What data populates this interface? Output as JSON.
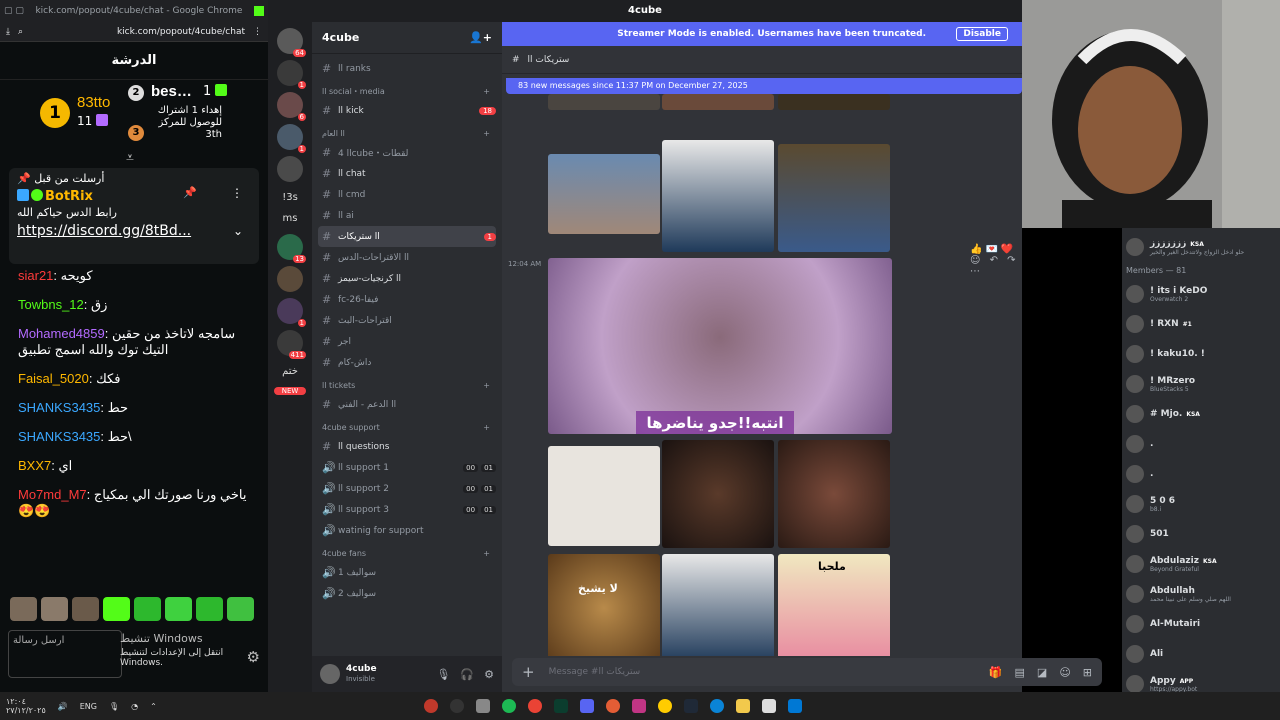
{
  "browser": {
    "title": "kick.com/popout/4cube/chat - Google Chrome",
    "url": "kick.com/popout/4cube/chat"
  },
  "kick": {
    "header": "الدرشة",
    "leaderboard": {
      "first_user": "83tto",
      "first_count": "11",
      "second_user": "bes…",
      "second_count": "1",
      "goal_line1": "إهداء 1 اشتراك",
      "goal_line2": "للوصول للمركز",
      "goal_line3": "3th",
      "rank1": "1",
      "rank2": "2",
      "rank3": "3"
    },
    "pinned": {
      "sent_by": "أرسلت من قبل",
      "bot_name": "BotRix",
      "message": "رابط الدس حياكم الله",
      "link": "https://discord.gg/8tBd..."
    },
    "messages": [
      {
        "user": "siar21",
        "text": ": كويحه",
        "color": "#ff3b3b"
      },
      {
        "user": "Towbns_12",
        "text": ": زق",
        "color": "#53fc18"
      },
      {
        "user": "Mohamed4859",
        "text": ": سامجه لاتاخذ من حقين التيك توك والله اسمج تطبيق",
        "color": "#b36bff"
      },
      {
        "user": "Faisal_5020",
        "text": ": فكك",
        "color": "#ffb800"
      },
      {
        "user": "SHANKS3435",
        "text": ": حط",
        "color": "#3ba8ff"
      },
      {
        "user": "SHANKS3435",
        "text": ": حط\\",
        "color": "#3ba8ff"
      },
      {
        "user": "BXX7",
        "text": ": اي",
        "color": "#ffb800"
      },
      {
        "user": "Mo7md_M7",
        "text": ": ياخي ورنا صورتك الي بمكياج 😍😍",
        "color": "#ff3b3b"
      }
    ],
    "input_placeholder": "ارسل رسالة",
    "windows_activate": "تنشيط Windows",
    "windows_activate_sub": "انتقل إلى الإعدادات لتنشيط Windows."
  },
  "discord": {
    "window_title": "4cube",
    "streamer_mode_text": "Streamer Mode is enabled. Usernames have been truncated.",
    "disable_button": "Disable",
    "guild_name": "4cube",
    "channel_name": "ستريكات اا",
    "new_messages_banner": "83 new messages since 11:37 PM on December 27, 2025",
    "timestamp": "12:04 AM",
    "overlay_caption": "انتبه!!جدو يناضرها",
    "image_caption_1": "لا يشيخ",
    "image_caption_2": "ملحبا",
    "composer_placeholder": "Message #ستريكات اا",
    "user_panel": {
      "name": "4cube",
      "status": "Invisible"
    },
    "servers": [
      {
        "badge": "64"
      },
      {
        "badge": "1"
      },
      {
        "badge": "6"
      },
      {
        "badge": "1"
      },
      {
        "badge": ""
      },
      {
        "badge": "13"
      },
      {
        "badge": ""
      },
      {
        "badge": "1"
      },
      {
        "badge": "411"
      }
    ],
    "server_texts": {
      "s1": "!3s",
      "s2": "ms",
      "s3": "ختم",
      "new": "NEW"
    },
    "channels": [
      {
        "type": "ch",
        "label": "اا ranks",
        "style": ""
      },
      {
        "type": "cat",
        "label": "اا social・media"
      },
      {
        "type": "ch",
        "label": "اا kick",
        "style": "white",
        "num": "18"
      },
      {
        "type": "cat",
        "label": "اا العام"
      },
      {
        "type": "ch",
        "label": "اا 4cube・لقطات",
        "style": ""
      },
      {
        "type": "ch",
        "label": "اا chat",
        "style": "white"
      },
      {
        "type": "ch",
        "label": "اا cmd",
        "style": ""
      },
      {
        "type": "ch",
        "label": "اا ai",
        "style": ""
      },
      {
        "type": "ch",
        "label": "اا ستريكات",
        "style": "active",
        "num": "1"
      },
      {
        "type": "ch",
        "label": "اا الاقتراحات-الدس",
        "style": ""
      },
      {
        "type": "ch",
        "label": "اا كرنجيات-سيمز",
        "style": "white"
      },
      {
        "type": "ch",
        "label": "fc-26-فيفا",
        "style": ""
      },
      {
        "type": "ch",
        "label": "اقتراحات-البث",
        "style": ""
      },
      {
        "type": "ch",
        "label": "اجر",
        "style": ""
      },
      {
        "type": "ch",
        "label": "داش-كام",
        "style": ""
      },
      {
        "type": "cat",
        "label": "اا tickets"
      },
      {
        "type": "ch",
        "label": "اا الدعم - الفني",
        "style": ""
      },
      {
        "type": "cat",
        "label": "4cube support"
      },
      {
        "type": "ch",
        "label": "اا questions",
        "style": "white"
      },
      {
        "type": "voice",
        "label": "اا support 1",
        "a": "00",
        "b": "01"
      },
      {
        "type": "voice",
        "label": "اا support 2",
        "a": "00",
        "b": "01"
      },
      {
        "type": "voice",
        "label": "اا support 3",
        "a": "00",
        "b": "01"
      },
      {
        "type": "voice",
        "label": "watinig for support"
      },
      {
        "type": "cat",
        "label": "4cube fans"
      },
      {
        "type": "voice",
        "label": "سواليف 1"
      },
      {
        "type": "voice",
        "label": "سواليف 2"
      }
    ],
    "members_header": "Members — 81",
    "members": [
      {
        "name": "ززززززز",
        "tag": "KSA",
        "status": "حلو ادخل الزواج ولاتتدخل الغير والخير"
      },
      {
        "name": "! its i KeDO",
        "status": "Overwatch 2"
      },
      {
        "name": "! RXN",
        "tag": "#1"
      },
      {
        "name": "! kaku10. !"
      },
      {
        "name": "! MRzero",
        "status": "BlueStacks 5"
      },
      {
        "name": "# Mjo.",
        "tag": "KSA"
      },
      {
        "name": "."
      },
      {
        "name": "."
      },
      {
        "name": "5 0 6",
        "status": "b8.i"
      },
      {
        "name": "501"
      },
      {
        "name": "Abdulaziz",
        "tag": "KSA",
        "status": "Beyond Grateful"
      },
      {
        "name": "Abdullah",
        "status": "اللهم صلي وسلم على نبينا محمد"
      },
      {
        "name": "Al-Mutairi"
      },
      {
        "name": "Ali"
      },
      {
        "name": "Appy",
        "tag": "APP",
        "status": "https://appy.bot"
      }
    ],
    "overlay_names": "SHANKS3435 BXX7"
  },
  "taskbar": {
    "time": "١٢:٠٤",
    "date": "٢٧/١٢/٢٠٢٥",
    "lang": "ENG"
  }
}
